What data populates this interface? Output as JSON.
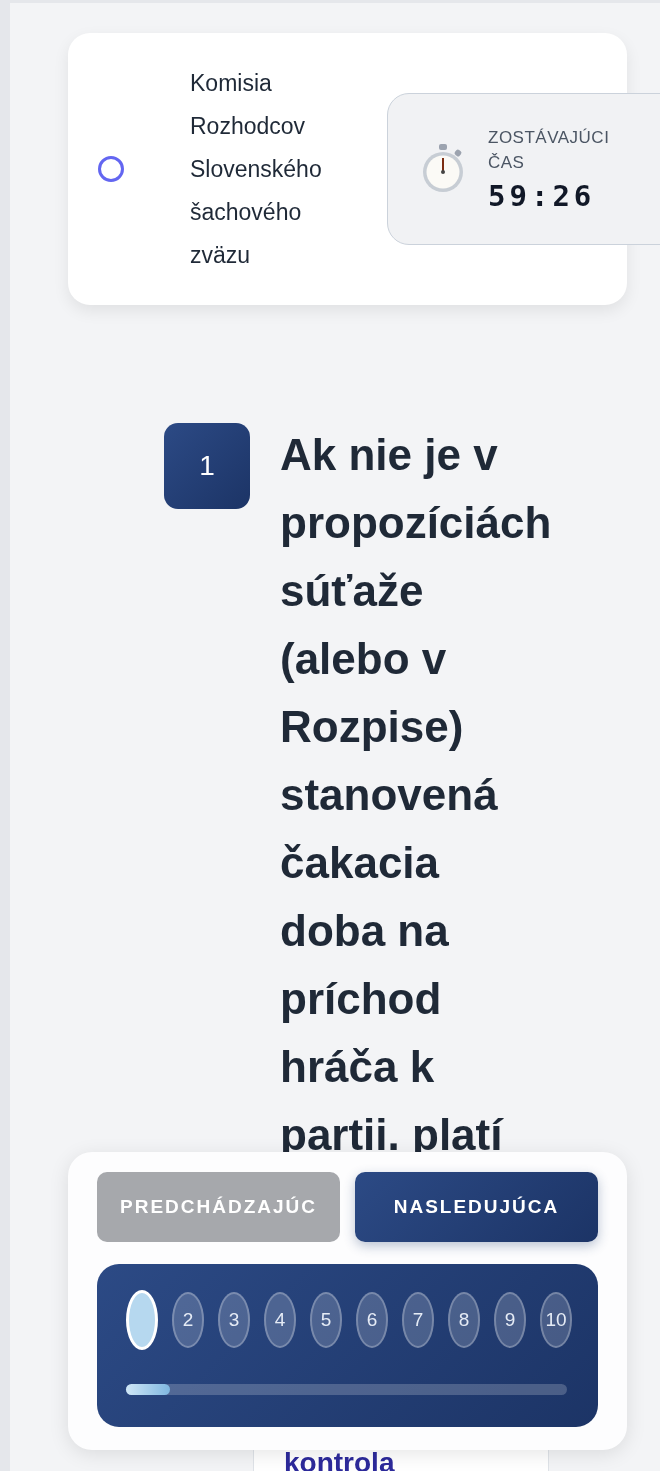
{
  "header": {
    "organization": {
      "name": "Komisia Rozhodcov Slovenského šachového zväzu",
      "selected": false
    },
    "timer": {
      "label": "ZOSTÁVAJÚCI ČAS",
      "value": "59:26"
    }
  },
  "question": {
    "number": "1",
    "text": "Ak nie je v\npropozíciách\nsúťaže\n(alebo v\nRozpise)\nstanovená\nčakacia\ndoba na\npríchod\nhráča k\npartii. platí",
    "answers": [
      {
        "text": "kontrola"
      }
    ]
  },
  "navigation": {
    "buttons": [
      {
        "label": "PREDCHÁDZAJÚC",
        "disabled": true
      },
      {
        "label": "NASLEDUJÚCA",
        "disabled": false
      }
    ],
    "pages": [
      {
        "selected": true
      },
      {
        "label": "2",
        "selected": false
      },
      {
        "label": "3",
        "selected": false
      },
      {
        "label": "4",
        "selected": false
      },
      {
        "label": "5",
        "selected": false
      },
      {
        "label": "6",
        "selected": false
      },
      {
        "label": "7",
        "selected": false
      },
      {
        "label": "8",
        "selected": false
      },
      {
        "label": "9",
        "selected": false
      },
      {
        "label": "10",
        "selected": false
      }
    ],
    "progress": {
      "level": 0.1
    }
  }
}
